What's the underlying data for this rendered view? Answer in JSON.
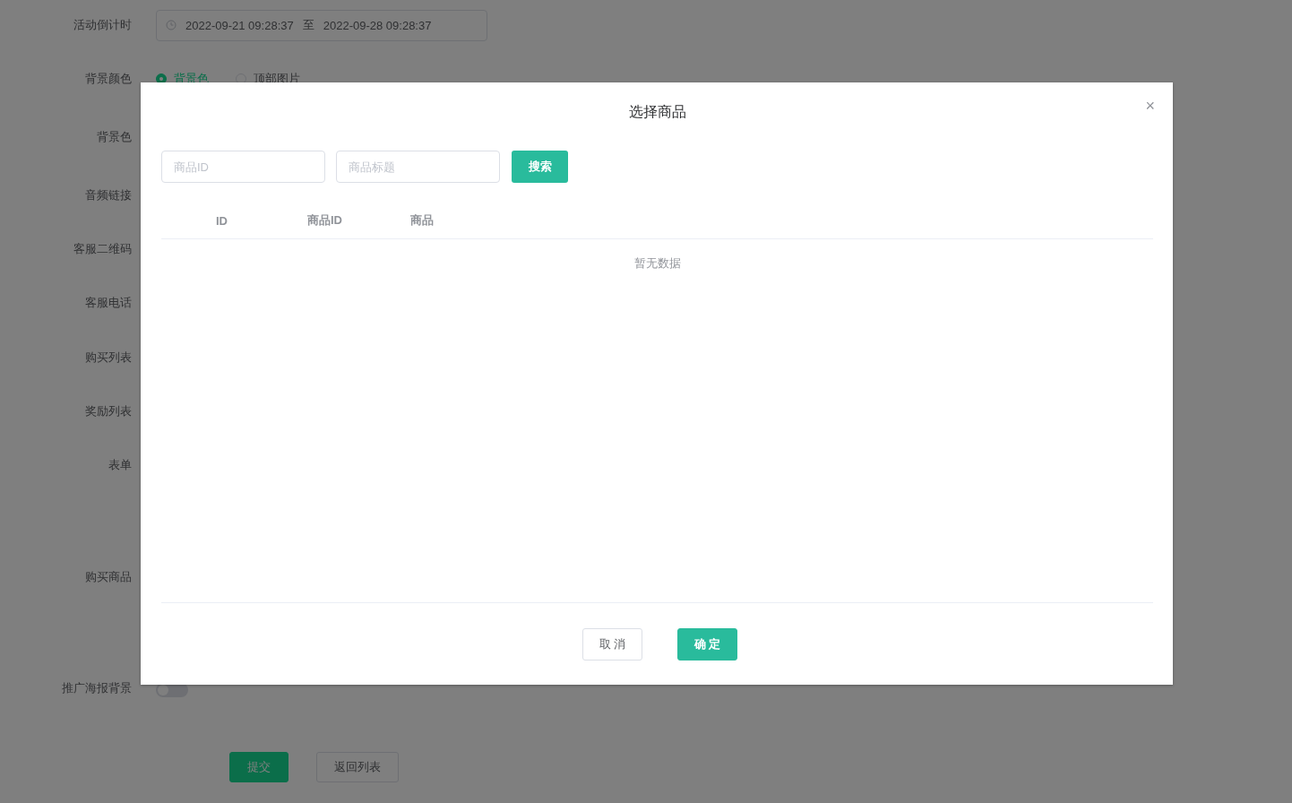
{
  "form": {
    "rows": [
      {
        "label": "活动倒计时",
        "kind": "daterange",
        "start": "2022-09-21 09:28:37",
        "separator": "至",
        "end": "2022-09-28 09:28:37"
      },
      {
        "label": "背景颜色",
        "kind": "radio",
        "options": [
          {
            "label": "背景色",
            "selected": true
          },
          {
            "label": "顶部图片",
            "selected": false
          }
        ]
      },
      {
        "label": "背景色",
        "kind": "empty"
      },
      {
        "label": "音频链接",
        "kind": "empty"
      },
      {
        "label": "客服二维码",
        "kind": "empty"
      },
      {
        "label": "客服电话",
        "kind": "empty"
      },
      {
        "label": "购买列表",
        "kind": "empty"
      },
      {
        "label": "奖励列表",
        "kind": "empty"
      },
      {
        "label": "表单",
        "kind": "empty"
      },
      {
        "label": "购买商品",
        "kind": "empty"
      },
      {
        "label": "推广海报背景",
        "kind": "switch",
        "on": false
      }
    ],
    "buttons": [
      {
        "label": "提交",
        "kind": "primary"
      },
      {
        "label": "返回列表",
        "kind": "default"
      }
    ]
  },
  "dialog": {
    "title": "选择商品",
    "close": "×",
    "search": [
      {
        "placeholder": "商品ID"
      },
      {
        "placeholder": "商品标题"
      }
    ],
    "search_button": "搜索",
    "table": {
      "columns": [
        "ID",
        "商品ID",
        "商品"
      ],
      "empty_text": "暂无数据"
    },
    "buttons": [
      {
        "label": "取 消",
        "kind": "default"
      },
      {
        "label": "确 定",
        "kind": "primary"
      }
    ]
  }
}
